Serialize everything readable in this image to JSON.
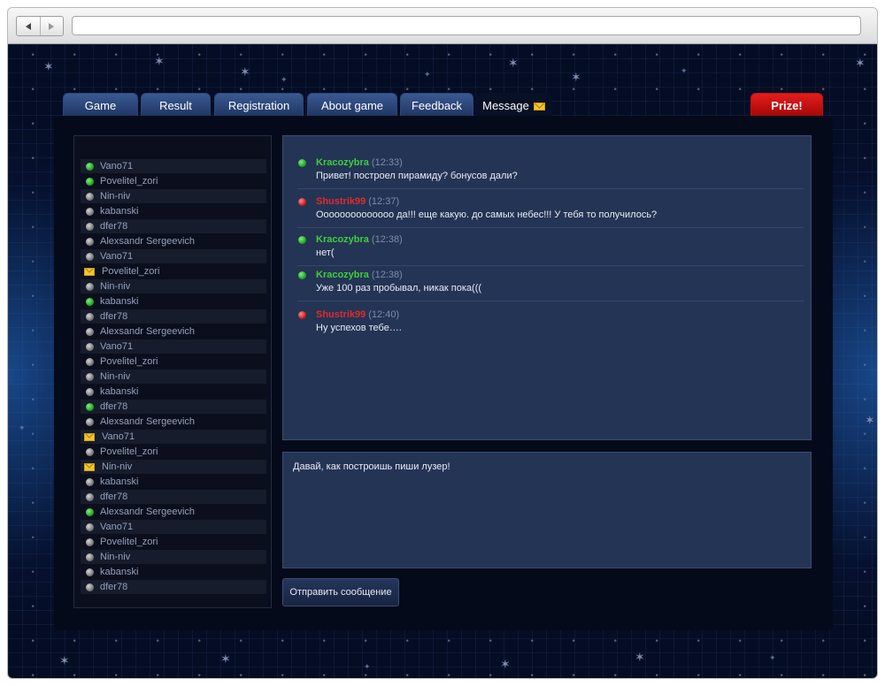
{
  "browser": {
    "back_icon": "back-arrow-icon",
    "forward_icon": "forward-arrow-icon",
    "address_value": ""
  },
  "tabs": [
    {
      "label": "Game"
    },
    {
      "label": "Result"
    },
    {
      "label": "Registration"
    },
    {
      "label": "About game"
    },
    {
      "label": "Feedback"
    },
    {
      "label": "Message",
      "active": true,
      "icon": "envelope-icon"
    }
  ],
  "prize_tab": {
    "label": "Prize!",
    "color": "#d01010"
  },
  "contacts": [
    {
      "name": "Vano71",
      "status": "online"
    },
    {
      "name": "Povelitel_zori",
      "status": "online"
    },
    {
      "name": "Nin-niv",
      "status": "offline"
    },
    {
      "name": "kabanski",
      "status": "offline"
    },
    {
      "name": "dfer78",
      "status": "offline"
    },
    {
      "name": "Alexsandr Sergeevich",
      "status": "offline"
    },
    {
      "name": "Vano71",
      "status": "offline"
    },
    {
      "name": "Povelitel_zori",
      "status": "message"
    },
    {
      "name": "Nin-niv",
      "status": "offline"
    },
    {
      "name": "kabanski",
      "status": "online"
    },
    {
      "name": "dfer78",
      "status": "offline"
    },
    {
      "name": "Alexsandr Sergeevich",
      "status": "offline"
    },
    {
      "name": "Vano71",
      "status": "offline"
    },
    {
      "name": "Povelitel_zori",
      "status": "offline"
    },
    {
      "name": "Nin-niv",
      "status": "offline"
    },
    {
      "name": "kabanski",
      "status": "offline"
    },
    {
      "name": "dfer78",
      "status": "online"
    },
    {
      "name": "Alexsandr Sergeevich",
      "status": "offline"
    },
    {
      "name": "Vano71",
      "status": "message"
    },
    {
      "name": "Povelitel_zori",
      "status": "offline"
    },
    {
      "name": "Nin-niv",
      "status": "message"
    },
    {
      "name": "kabanski",
      "status": "offline"
    },
    {
      "name": "dfer78",
      "status": "offline"
    },
    {
      "name": "Alexsandr Sergeevich",
      "status": "online"
    },
    {
      "name": "Vano71",
      "status": "offline"
    },
    {
      "name": "Povelitel_zori",
      "status": "offline"
    },
    {
      "name": "Nin-niv",
      "status": "offline"
    },
    {
      "name": "kabanski",
      "status": "offline"
    },
    {
      "name": "dfer78",
      "status": "offline"
    }
  ],
  "messages": [
    {
      "author": "Kracozybra",
      "time": "(12:33)",
      "text": "Привет! построел пирамиду? бонусов дали?",
      "status": "online"
    },
    {
      "author": "Shustrik99",
      "time": "(12:37)",
      "text": "Оооооооооооооо да!!! еще какую. до самых небес!!! У тебя то получилось?",
      "status": "busy"
    },
    {
      "author": "Kracozybra",
      "time": "(12:38)",
      "text": "нет(",
      "status": "online"
    },
    {
      "author": "Kracozybra",
      "time": "(12:38)",
      "text": "Уже 100 раз пробывал, никак пока(((",
      "status": "online"
    },
    {
      "author": "Shustrik99",
      "time": "(12:40)",
      "text": "Ну успехов тебе….",
      "status": "busy"
    }
  ],
  "compose": {
    "value": "Давай, как построишь пиши лузер!"
  },
  "send_button": {
    "label": "Отправить сообщение"
  }
}
